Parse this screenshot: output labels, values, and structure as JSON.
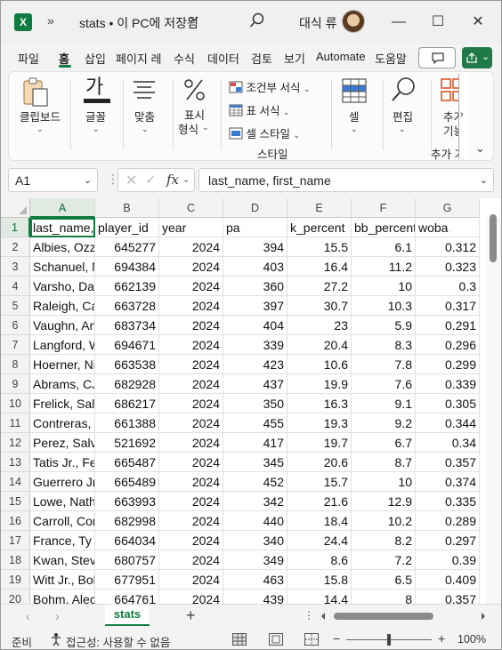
{
  "titlebar": {
    "app_letter": "X",
    "more": "»",
    "title": "stats • 이 PC에 저장됨",
    "user": "대식 류",
    "minimize": "—",
    "maximize": "☐",
    "close": "✕"
  },
  "tabs": [
    "파일",
    "홈",
    "삽입",
    "페이지 레",
    "수식",
    "데이터",
    "검토",
    "보기",
    "Automate",
    "도움말"
  ],
  "ribbon": {
    "clipboard": "클립보드",
    "font": "글꼴",
    "align": "맞춤",
    "number_line1": "표시",
    "number_line2": "형식",
    "cond_format": "조건부 서식",
    "table_format": "표 서식",
    "cell_style": "셀 스타일",
    "styles_group": "스타일",
    "cells": "셀",
    "edit": "편집",
    "addins_line1": "추가",
    "addins_line2": "기능",
    "addins_group": "추가 기"
  },
  "formula_bar": {
    "name_box": "A1",
    "fx": "fx",
    "content": "last_name, first_name"
  },
  "grid": {
    "columns": [
      "A",
      "B",
      "C",
      "D",
      "E",
      "F",
      "G"
    ],
    "rows": [
      [
        "last_name, first_name",
        "player_id",
        "year",
        "pa",
        "k_percent",
        "bb_percent",
        "woba"
      ],
      [
        "Albies, Ozzie",
        "645277",
        "2024",
        "394",
        "15.5",
        "6.1",
        "0.312"
      ],
      [
        "Schanuel, Nolan",
        "694384",
        "2024",
        "403",
        "16.4",
        "11.2",
        "0.323"
      ],
      [
        "Varsho, Daulton",
        "662139",
        "2024",
        "360",
        "27.2",
        "10",
        "0.3"
      ],
      [
        "Raleigh, Cal",
        "663728",
        "2024",
        "397",
        "30.7",
        "10.3",
        "0.317"
      ],
      [
        "Vaughn, Andrew",
        "683734",
        "2024",
        "404",
        "23",
        "5.9",
        "0.291"
      ],
      [
        "Langford, Wyatt",
        "694671",
        "2024",
        "339",
        "20.4",
        "8.3",
        "0.296"
      ],
      [
        "Hoerner, Nico",
        "663538",
        "2024",
        "423",
        "10.6",
        "7.8",
        "0.299"
      ],
      [
        "Abrams, CJ",
        "682928",
        "2024",
        "437",
        "19.9",
        "7.6",
        "0.339"
      ],
      [
        "Frelick, Sal",
        "686217",
        "2024",
        "350",
        "16.3",
        "9.1",
        "0.305"
      ],
      [
        "Contreras, William",
        "661388",
        "2024",
        "455",
        "19.3",
        "9.2",
        "0.344"
      ],
      [
        "Perez, Salvador",
        "521692",
        "2024",
        "417",
        "19.7",
        "6.7",
        "0.34"
      ],
      [
        "Tatis Jr., Fernando",
        "665487",
        "2024",
        "345",
        "20.6",
        "8.7",
        "0.357"
      ],
      [
        "Guerrero Jr., Vladimir",
        "665489",
        "2024",
        "452",
        "15.7",
        "10",
        "0.374"
      ],
      [
        "Lowe, Nathaniel",
        "663993",
        "2024",
        "342",
        "21.6",
        "12.9",
        "0.335"
      ],
      [
        "Carroll, Corbin",
        "682998",
        "2024",
        "440",
        "18.4",
        "10.2",
        "0.289"
      ],
      [
        "France, Ty",
        "664034",
        "2024",
        "340",
        "24.4",
        "8.2",
        "0.297"
      ],
      [
        "Kwan, Steven",
        "680757",
        "2024",
        "349",
        "8.6",
        "7.2",
        "0.39"
      ],
      [
        "Witt Jr., Bobby",
        "677951",
        "2024",
        "463",
        "15.8",
        "6.5",
        "0.409"
      ],
      [
        "Bohm, Alec",
        "664761",
        "2024",
        "439",
        "14.4",
        "8",
        "0.357"
      ]
    ]
  },
  "sheetbar": {
    "prev": "‹",
    "next": "›",
    "sheet_name": "stats",
    "add": "+"
  },
  "statusbar": {
    "ready": "준비",
    "accessibility": "접근성: 사용할 수 없음",
    "zoom_minus": "−",
    "zoom_plus": "+",
    "zoom": "100%"
  }
}
